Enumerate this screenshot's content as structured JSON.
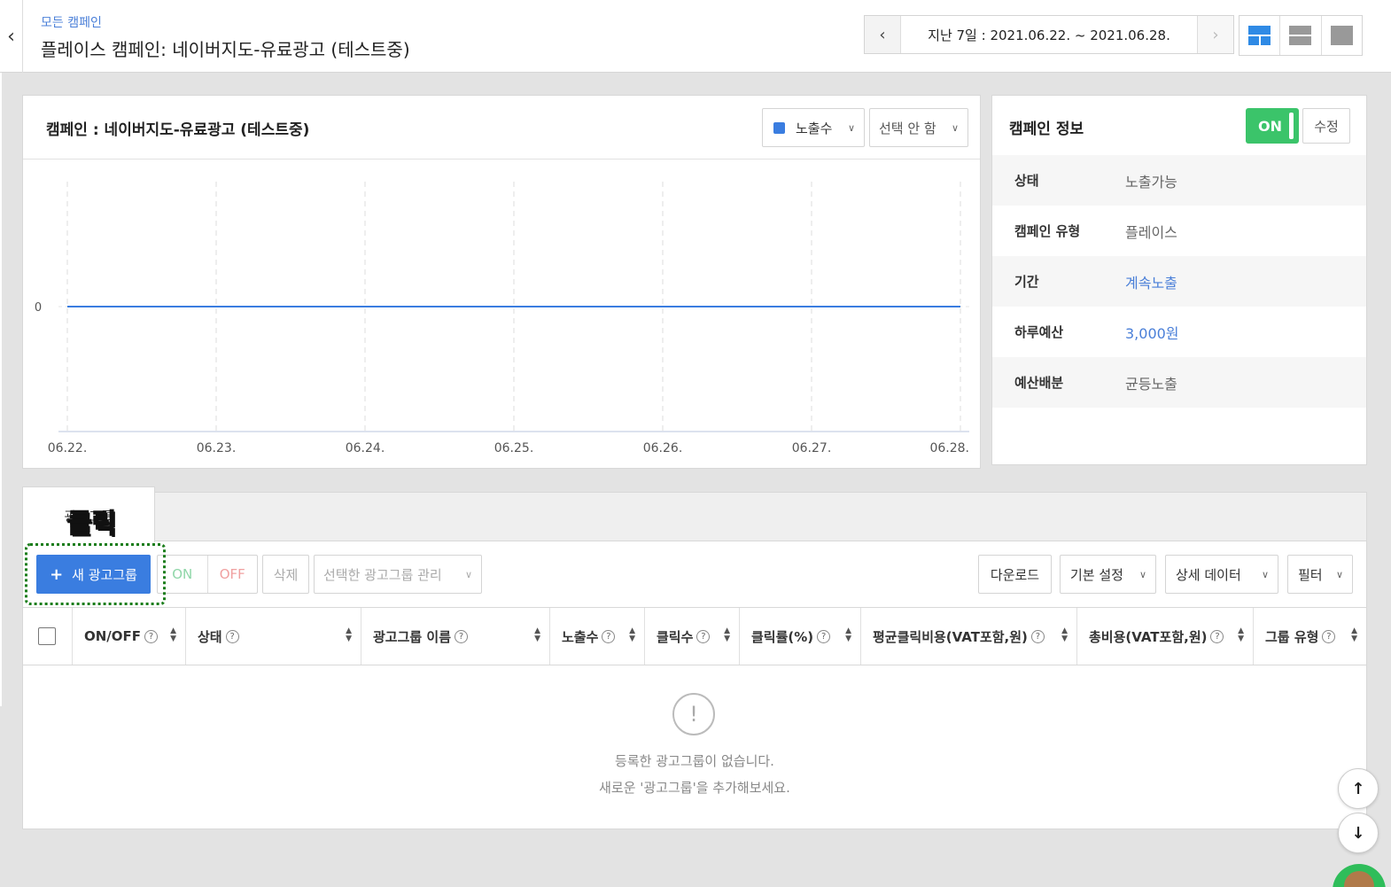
{
  "header": {
    "breadcrumb": "모든 캠페인",
    "title": "플레이스 캠페인: 네이버지도-유료광고 (테스트중)",
    "date_range": "지난 7일 : 2021.06.22. ~ 2021.06.28."
  },
  "chart_card": {
    "title": "캠페인 : 네이버지도-유료광고 (테스트중)",
    "metric_select": "노출수",
    "compare_select": "선택 안 함"
  },
  "chart_data": {
    "type": "line",
    "categories": [
      "06.22.",
      "06.23.",
      "06.24.",
      "06.25.",
      "06.26.",
      "06.27.",
      "06.28."
    ],
    "series": [
      {
        "values": [
          0,
          0,
          0,
          0,
          0,
          0,
          0
        ],
        "color": "#3a7de0"
      }
    ],
    "y_ticks": [
      "0"
    ],
    "grid": "vertical-dashed"
  },
  "info_card": {
    "title": "캠페인 정보",
    "toggle_label": "ON",
    "edit_label": "수정",
    "rows": [
      {
        "key": "상태",
        "value": "노출가능"
      },
      {
        "key": "캠페인 유형",
        "value": "플레이스"
      },
      {
        "key": "기간",
        "value": "계속노출"
      },
      {
        "key": "하루예산",
        "value": "3,000원"
      },
      {
        "key": "예산배분",
        "value": "균등노출"
      }
    ]
  },
  "tabs": {
    "active": "광고그룹"
  },
  "annotation": {
    "click_label": "클릭"
  },
  "toolbar": {
    "new_group": "새 광고그룹",
    "on": "ON",
    "off": "OFF",
    "delete": "삭제",
    "manage": "선택한 광고그룹 관리",
    "download": "다운로드",
    "basic_settings": "기본 설정",
    "detail_data": "상세 데이터",
    "filter": "필터"
  },
  "table": {
    "columns": [
      "ON/OFF",
      "상태",
      "광고그룹 이름",
      "노출수",
      "클릭수",
      "클릭률(%)",
      "평균클릭비용(VAT포함,원)",
      "총비용(VAT포함,원)",
      "그룹 유형"
    ]
  },
  "empty_state": {
    "line1": "등록한 광고그룹이 없습니다.",
    "line2": "새로운 '광고그룹'을 추가해보세요."
  },
  "colors": {
    "accent": "#3a7de0",
    "on_green": "#3bc46a",
    "link": "#4a7fd8"
  }
}
